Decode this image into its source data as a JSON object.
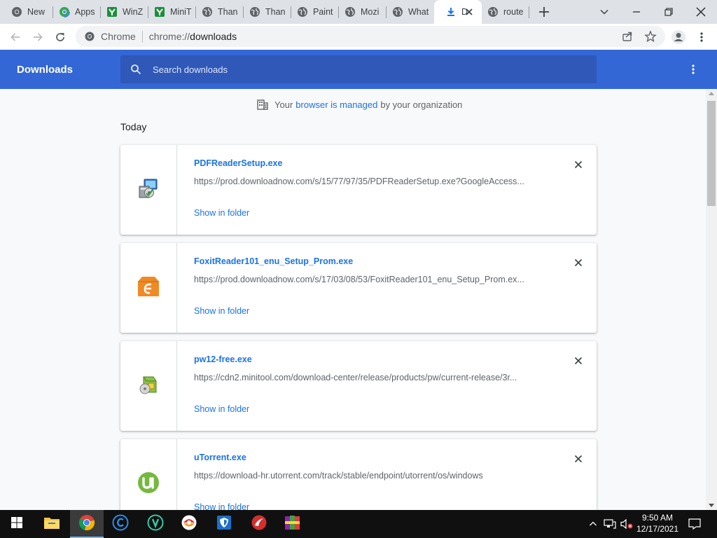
{
  "window": {
    "tabs": [
      {
        "label": "New",
        "icon": "chrome-icon"
      },
      {
        "label": "Apps",
        "icon": "apps-icon"
      },
      {
        "label": "WinZ",
        "icon": "winzip-icon"
      },
      {
        "label": "MiniT",
        "icon": "minitool-icon"
      },
      {
        "label": "Than",
        "icon": "globe-icon"
      },
      {
        "label": "Than",
        "icon": "globe-icon"
      },
      {
        "label": "Paint",
        "icon": "globe-icon"
      },
      {
        "label": "Mozi",
        "icon": "globe-icon"
      },
      {
        "label": "What",
        "icon": "globe-icon"
      },
      {
        "label": "D",
        "icon": "download-icon",
        "active": true
      },
      {
        "label": "route",
        "icon": "globe-icon"
      }
    ],
    "controls": [
      "tab-search",
      "minimize",
      "restore",
      "close"
    ]
  },
  "toolbar": {
    "site_label": "Chrome",
    "url_scheme": "chrome://",
    "url_host": "downloads"
  },
  "downloads": {
    "title": "Downloads",
    "search_placeholder": "Search downloads",
    "managed": {
      "prefix": "Your",
      "link": "browser is managed",
      "suffix": "by your organization"
    },
    "section": "Today",
    "items": [
      {
        "filename": "PDFReaderSetup.exe",
        "url": "https://prod.downloadnow.com/s/15/77/97/35/PDFReaderSetup.exe?GoogleAccess...",
        "action": "Show in folder",
        "icon": "installer-icon"
      },
      {
        "filename": "FoxitReader101_enu_Setup_Prom.exe",
        "url": "https://prod.downloadnow.com/s/17/03/08/53/FoxitReader101_enu_Setup_Prom.ex...",
        "action": "Show in folder",
        "icon": "foxit-icon"
      },
      {
        "filename": "pw12-free.exe",
        "url": "https://cdn2.minitool.com/download-center/release/products/pw/current-release/3r...",
        "action": "Show in folder",
        "icon": "minitool-setup-icon"
      },
      {
        "filename": "uTorrent.exe",
        "url": "https://download-hr.utorrent.com/track/stable/endpoint/utorrent/os/windows",
        "action": "Show in folder",
        "icon": "utorrent-icon"
      }
    ]
  },
  "taskbar": {
    "apps": [
      "start-icon",
      "file-explorer-icon",
      "chrome-icon",
      "ccleaner-icon",
      "update-icon",
      "avg-icon",
      "shield-icon",
      "rescue-icon",
      "winrar-icon"
    ],
    "time": "9:50 AM",
    "date": "12/17/2021"
  },
  "colors": {
    "accent": "#3367d6",
    "link": "#1a73e8",
    "tabstrip": "#dee1e6"
  }
}
